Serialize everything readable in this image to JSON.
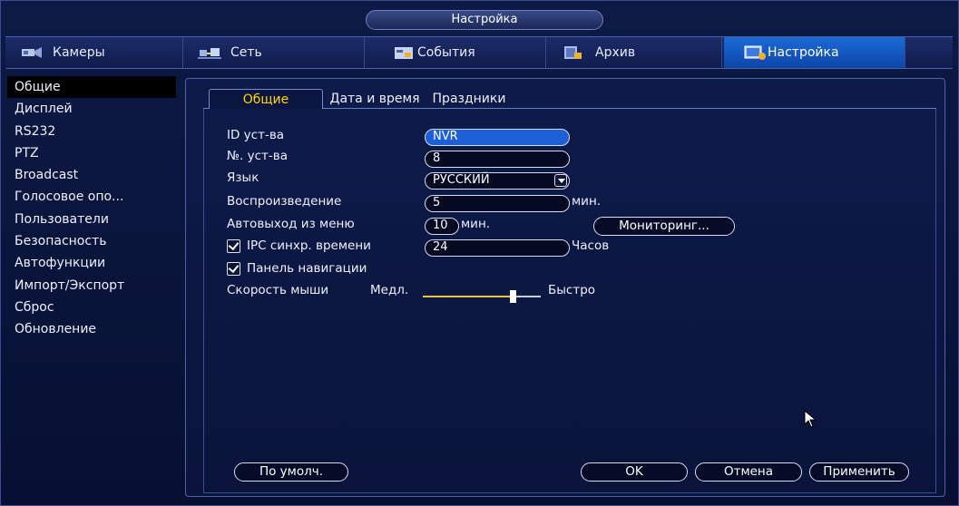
{
  "window": {
    "title": "Настройка"
  },
  "menu": [
    {
      "label": "Камеры",
      "icon": "camera-icon"
    },
    {
      "label": "Сеть",
      "icon": "network-icon"
    },
    {
      "label": "События",
      "icon": "events-icon"
    },
    {
      "label": "Архив",
      "icon": "archive-icon"
    },
    {
      "label": "Настройка",
      "icon": "settings-icon",
      "active": true
    }
  ],
  "sidebar": {
    "items": [
      {
        "label": "Общие",
        "active": true
      },
      {
        "label": "Дисплей"
      },
      {
        "label": "RS232"
      },
      {
        "label": "PTZ"
      },
      {
        "label": "Broadcast"
      },
      {
        "label": "Голосовое опо..."
      },
      {
        "label": "Пользователи"
      },
      {
        "label": "Безопасность"
      },
      {
        "label": "Автофункции"
      },
      {
        "label": "Импорт/Экспорт"
      },
      {
        "label": "Сброс"
      },
      {
        "label": "Обновление"
      }
    ]
  },
  "tabs": [
    {
      "label": "Общие",
      "active": true
    },
    {
      "label": "Дата и время"
    },
    {
      "label": "Праздники"
    }
  ],
  "form": {
    "device_id_label": "ID уст-ва",
    "device_id_value": "NVR",
    "device_no_label": "№. уст-ва",
    "device_no_value": "8",
    "language_label": "Язык",
    "language_value": "РУССКИЙ",
    "playback_label": "Воспроизведение",
    "playback_value": "5",
    "playback_unit": "мин.",
    "autologout_label": "Автовыход из меню",
    "autologout_value": "10",
    "autologout_unit": "мин.",
    "monitoring_button": "Мониторинг...",
    "ipc_sync_label": "IPC синхр. времени",
    "ipc_sync_value": "24",
    "ipc_sync_unit": "Часов",
    "nav_panel_label": "Панель навигации",
    "mouse_speed_label": "Скорость мыши",
    "mouse_speed_min": "Медл.",
    "mouse_speed_max": "Быстро"
  },
  "footer": {
    "default_button": "По умолч.",
    "ok_button": "OK",
    "cancel_button": "Отмена",
    "apply_button": "Применить"
  },
  "colors": {
    "accent": "#1c5fd6",
    "active_tab_text": "#ffd400",
    "background": "#0a1230"
  }
}
